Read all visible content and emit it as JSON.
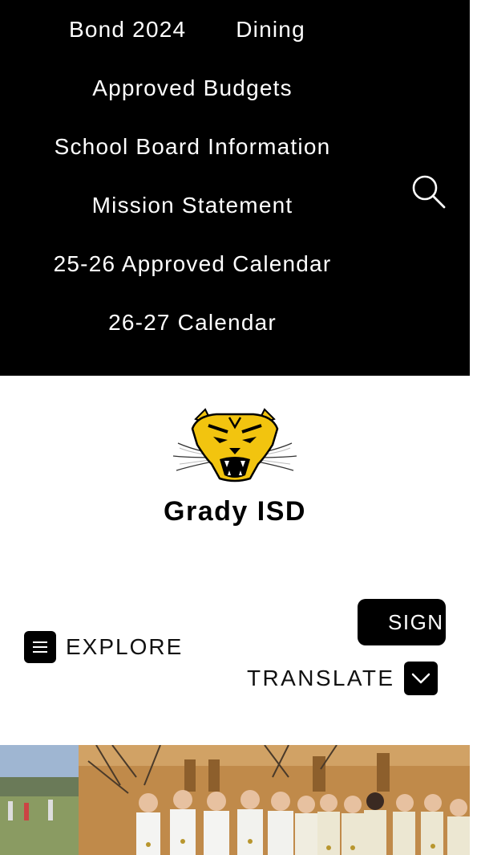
{
  "top_nav": {
    "links": [
      "Bond 2024",
      "Dining",
      "Approved Budgets",
      "School Board Information",
      "Mission Statement",
      "25-26 Approved Calendar",
      "26-27 Calendar"
    ]
  },
  "header": {
    "logo_icon": "wildcat-mascot-logo",
    "school_name": "Grady ISD"
  },
  "actions": {
    "explore_label": "EXPLORE",
    "sign_label": "SIGN",
    "translate_label": "TRANSLATE"
  },
  "banner": {
    "image": "student-team-photo"
  },
  "colors": {
    "nav_bg": "#000000",
    "accent_gold": "#f2c40f",
    "text": "#111111"
  }
}
